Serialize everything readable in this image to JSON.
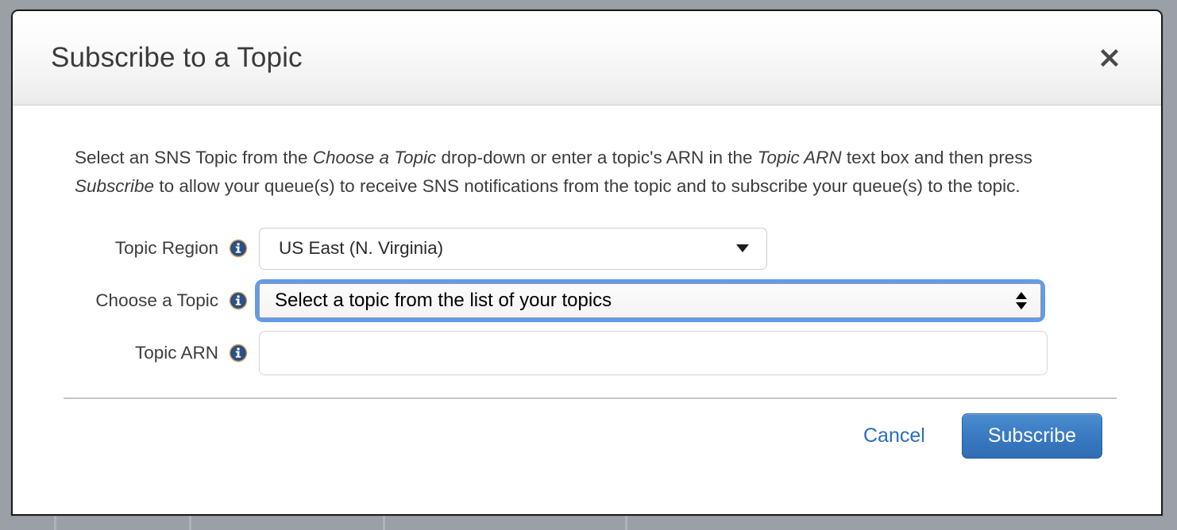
{
  "dialog": {
    "title": "Subscribe to a Topic",
    "close_icon": "close-x-icon",
    "intro": {
      "seg1": "Select an SNS Topic from the ",
      "em1": "Choose a Topic",
      "seg2": " drop-down or enter a topic's ARN in the ",
      "em2": "Topic ARN",
      "seg3": " text box and then press ",
      "em3": "Subscribe",
      "seg4": " to allow your queue(s) to receive SNS notifications from the topic and to subscribe your queue(s) to the topic."
    },
    "form": {
      "topic_region": {
        "label": "Topic Region",
        "info_icon": "info-icon",
        "value": "US East (N. Virginia)",
        "caret_icon": "chevron-down-icon"
      },
      "choose_topic": {
        "label": "Choose a Topic",
        "info_icon": "info-icon",
        "value": "Select a topic from the list of your topics",
        "spinner_icon": "spinner-up-down-icon",
        "focused": true
      },
      "topic_arn": {
        "label": "Topic ARN",
        "info_icon": "info-icon",
        "value": "",
        "placeholder": ""
      }
    },
    "footer": {
      "cancel_label": "Cancel",
      "subscribe_label": "Subscribe"
    }
  },
  "colors": {
    "overlay": "#9aa0a6",
    "accent_blue": "#3a7bc2",
    "link_blue": "#2a6ebb",
    "focus_ring": "#5a96eb",
    "title_text": "#3b3b3b",
    "body_text": "#3d3d3d"
  },
  "backdrop": {
    "column_dividers_x": [
      68,
      238,
      482,
      787
    ]
  }
}
